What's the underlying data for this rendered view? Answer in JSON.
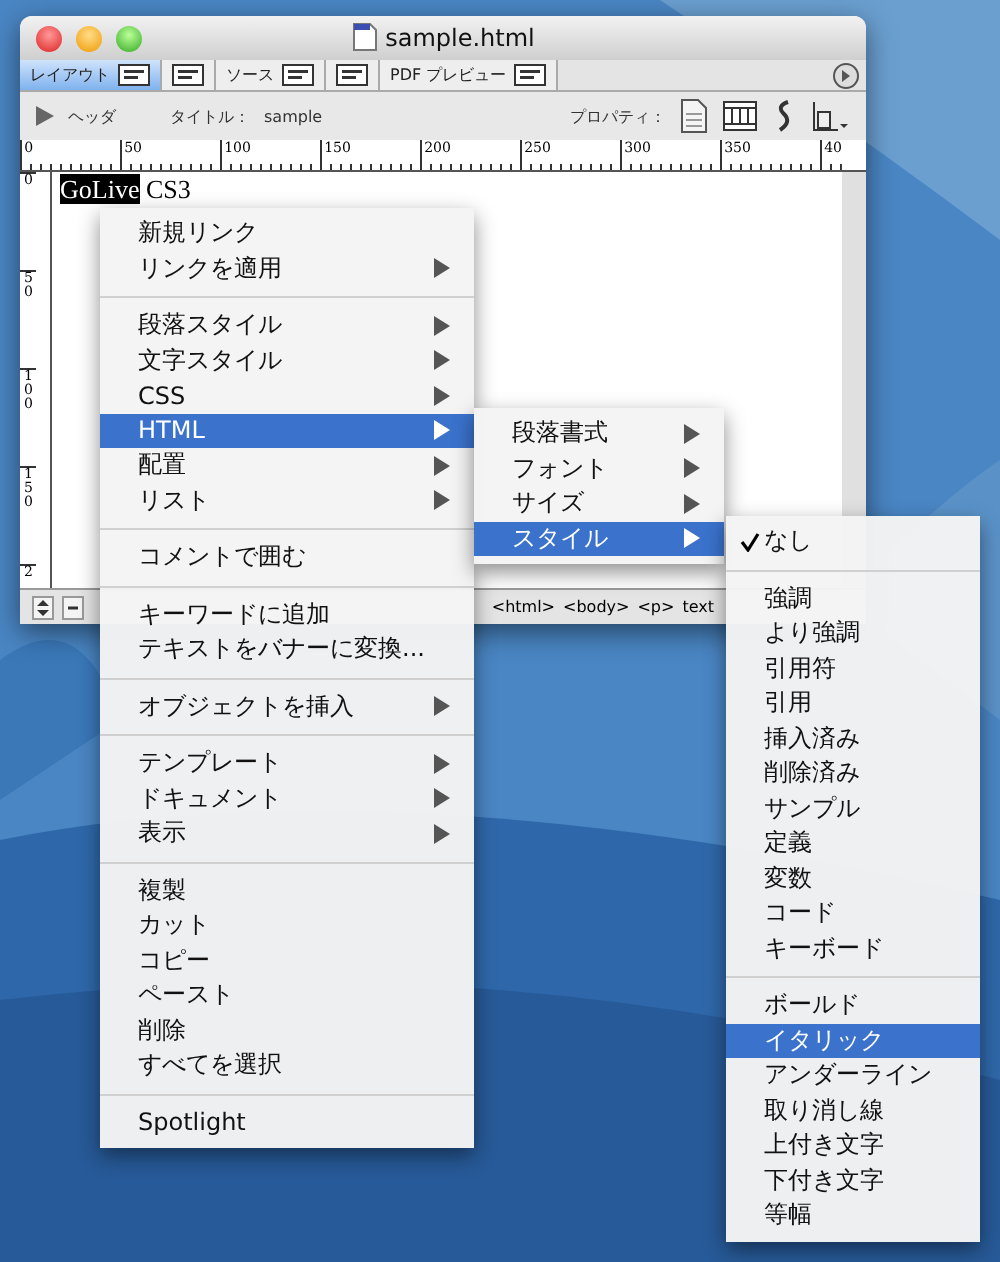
{
  "window": {
    "title": "sample.html",
    "tabs": [
      {
        "label": "レイアウト",
        "selected": true
      },
      {
        "selected": false
      },
      {
        "label": "ソース",
        "selected": false
      },
      {
        "selected": false
      },
      {
        "label": "PDF プレビュー",
        "selected": false
      }
    ],
    "toolbar": {
      "header_label": "ヘッダ",
      "title_label": "タイトル：",
      "title_value": "sample",
      "properties_label": "プロパティ："
    },
    "ruler_marks": [
      "0",
      "50",
      "100",
      "150",
      "200",
      "250",
      "300",
      "350",
      "40"
    ],
    "vertical_ruler_marks": [
      "0",
      "50",
      "100",
      "150",
      "2"
    ],
    "document_text": {
      "highlighted": "GoLive",
      "rest": "CS3"
    },
    "status_bar": {
      "path": [
        "<html>",
        "<body>",
        "<p>",
        "text"
      ]
    }
  },
  "context_menu": [
    {
      "kind": "item",
      "label": "新規リンク",
      "submenu": false,
      "selected": false
    },
    {
      "kind": "item",
      "label": "リンクを適用",
      "submenu": true,
      "selected": false
    },
    {
      "kind": "separator"
    },
    {
      "kind": "item",
      "label": "段落スタイル",
      "submenu": true,
      "selected": false
    },
    {
      "kind": "item",
      "label": "文字スタイル",
      "submenu": true,
      "selected": false
    },
    {
      "kind": "item",
      "label": "CSS",
      "submenu": true,
      "selected": false
    },
    {
      "kind": "item",
      "label": "HTML",
      "submenu": true,
      "selected": true
    },
    {
      "kind": "item",
      "label": "配置",
      "submenu": true,
      "selected": false
    },
    {
      "kind": "item",
      "label": "リスト",
      "submenu": true,
      "selected": false
    },
    {
      "kind": "separator"
    },
    {
      "kind": "item",
      "label": "コメントで囲む",
      "submenu": false,
      "selected": false
    },
    {
      "kind": "separator"
    },
    {
      "kind": "item",
      "label": "キーワードに追加",
      "submenu": false,
      "selected": false
    },
    {
      "kind": "item",
      "label": "テキストをバナーに変換...",
      "submenu": false,
      "selected": false
    },
    {
      "kind": "separator"
    },
    {
      "kind": "item",
      "label": "オブジェクトを挿入",
      "submenu": true,
      "selected": false
    },
    {
      "kind": "separator"
    },
    {
      "kind": "item",
      "label": "テンプレート",
      "submenu": true,
      "selected": false
    },
    {
      "kind": "item",
      "label": "ドキュメント",
      "submenu": true,
      "selected": false
    },
    {
      "kind": "item",
      "label": "表示",
      "submenu": true,
      "selected": false
    },
    {
      "kind": "separator"
    },
    {
      "kind": "item",
      "label": "複製",
      "submenu": false,
      "selected": false
    },
    {
      "kind": "item",
      "label": "カット",
      "submenu": false,
      "selected": false
    },
    {
      "kind": "item",
      "label": "コピー",
      "submenu": false,
      "selected": false
    },
    {
      "kind": "item",
      "label": "ペースト",
      "submenu": false,
      "selected": false
    },
    {
      "kind": "item",
      "label": "削除",
      "submenu": false,
      "selected": false
    },
    {
      "kind": "item",
      "label": "すべてを選択",
      "submenu": false,
      "selected": false
    },
    {
      "kind": "separator"
    },
    {
      "kind": "item",
      "label": "Spotlight",
      "submenu": false,
      "selected": false
    }
  ],
  "html_submenu": [
    {
      "kind": "item",
      "label": "段落書式",
      "submenu": true,
      "selected": false
    },
    {
      "kind": "item",
      "label": "フォント",
      "submenu": true,
      "selected": false
    },
    {
      "kind": "item",
      "label": "サイズ",
      "submenu": true,
      "selected": false
    },
    {
      "kind": "item",
      "label": "スタイル",
      "submenu": true,
      "selected": true
    }
  ],
  "style_submenu": [
    {
      "kind": "item",
      "label": "なし",
      "checked": true,
      "selected": false
    },
    {
      "kind": "separator"
    },
    {
      "kind": "item",
      "label": "強調",
      "checked": false,
      "selected": false
    },
    {
      "kind": "item",
      "label": "より強調",
      "checked": false,
      "selected": false
    },
    {
      "kind": "item",
      "label": "引用符",
      "checked": false,
      "selected": false
    },
    {
      "kind": "item",
      "label": "引用",
      "checked": false,
      "selected": false
    },
    {
      "kind": "item",
      "label": "挿入済み",
      "checked": false,
      "selected": false
    },
    {
      "kind": "item",
      "label": "削除済み",
      "checked": false,
      "selected": false
    },
    {
      "kind": "item",
      "label": "サンプル",
      "checked": false,
      "selected": false
    },
    {
      "kind": "item",
      "label": "定義",
      "checked": false,
      "selected": false
    },
    {
      "kind": "item",
      "label": "変数",
      "checked": false,
      "selected": false
    },
    {
      "kind": "item",
      "label": "コード",
      "checked": false,
      "selected": false
    },
    {
      "kind": "item",
      "label": "キーボード",
      "checked": false,
      "selected": false
    },
    {
      "kind": "separator"
    },
    {
      "kind": "item",
      "label": "ボールド",
      "checked": false,
      "selected": false
    },
    {
      "kind": "item",
      "label": "イタリック",
      "checked": false,
      "selected": true
    },
    {
      "kind": "item",
      "label": "アンダーライン",
      "checked": false,
      "selected": false
    },
    {
      "kind": "item",
      "label": "取り消し線",
      "checked": false,
      "selected": false
    },
    {
      "kind": "item",
      "label": "上付き文字",
      "checked": false,
      "selected": false
    },
    {
      "kind": "item",
      "label": "下付き文字",
      "checked": false,
      "selected": false
    },
    {
      "kind": "item",
      "label": "等幅",
      "checked": false,
      "selected": false
    }
  ]
}
